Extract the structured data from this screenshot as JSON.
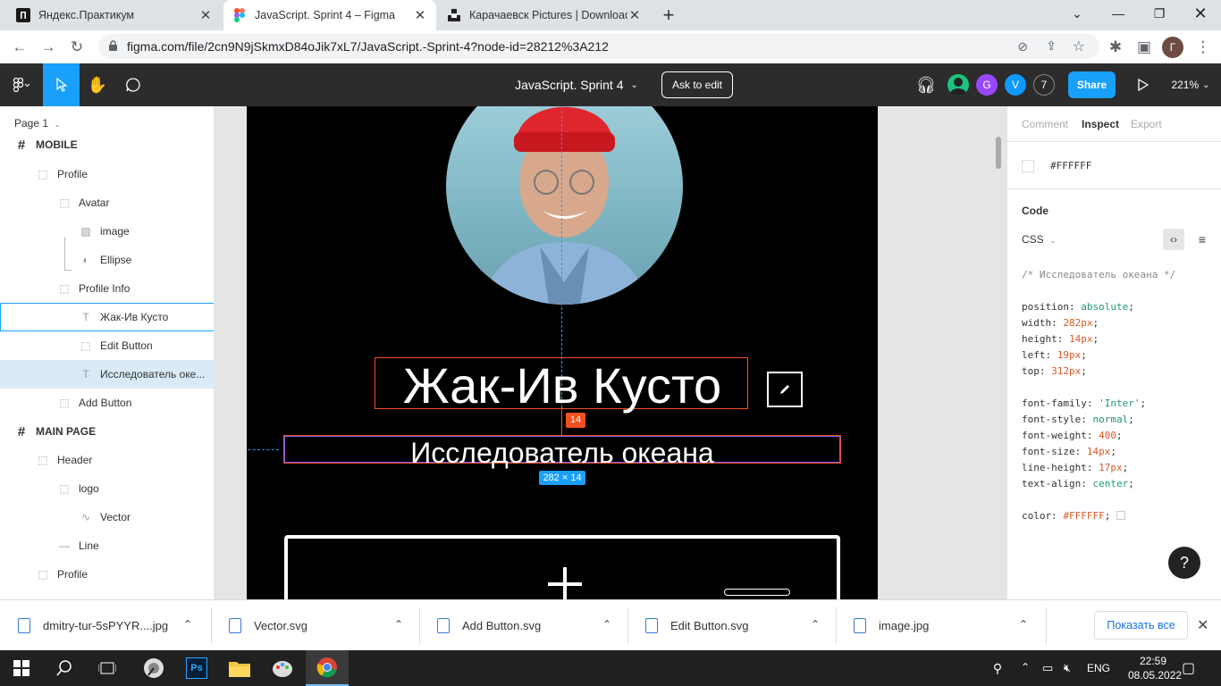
{
  "browser": {
    "tabs": [
      {
        "title": "Яндекс.Практикум",
        "active": false
      },
      {
        "title": "JavaScript. Sprint 4 – Figma",
        "active": true
      },
      {
        "title": "Карачаевск Pictures | Download",
        "active": false
      }
    ],
    "new_tab": "+",
    "url": "figma.com/file/2cn9N9jSkmxD84oJik7xL7/JavaScript.-Sprint-4?node-id=28212%3A212",
    "profile_initial": "Г"
  },
  "figma": {
    "file_title": "JavaScript. Sprint 4",
    "ask_to_edit": "Ask to edit",
    "share": "Share",
    "zoom": "221%",
    "users": [
      "G",
      "V"
    ],
    "user_count": "7",
    "page": "Page 1",
    "layers": [
      {
        "label": "MOBILE",
        "icon": "frame-icon",
        "indent": 0,
        "frame": true
      },
      {
        "label": "Profile",
        "icon": "group-dashed-icon",
        "indent": 1
      },
      {
        "label": "Avatar",
        "icon": "group-dashed-icon",
        "indent": 2
      },
      {
        "label": "image",
        "icon": "image-icon",
        "indent": 3
      },
      {
        "label": "Ellipse",
        "icon": "ellipse-half-icon",
        "indent": 3
      },
      {
        "label": "Profile Info",
        "icon": "group-dashed-icon",
        "indent": 2
      },
      {
        "label": "Жак-Ив Кусто",
        "icon": "text-icon",
        "indent": 3,
        "hover": true
      },
      {
        "label": "Edit Button",
        "icon": "group-dashed-icon",
        "indent": 3
      },
      {
        "label": "Исследователь оке...",
        "icon": "text-icon",
        "indent": 3,
        "selected": true
      },
      {
        "label": "Add Button",
        "icon": "group-dashed-icon",
        "indent": 2
      },
      {
        "label": "MAIN PAGE",
        "icon": "frame-icon",
        "indent": 0,
        "frame": true
      },
      {
        "label": "Header",
        "icon": "group-dashed-icon",
        "indent": 1
      },
      {
        "label": "logo",
        "icon": "group-dashed-icon",
        "indent": 2
      },
      {
        "label": "Vector",
        "icon": "vector-icon",
        "indent": 3
      },
      {
        "label": "Line",
        "icon": "line-icon",
        "indent": 2
      },
      {
        "label": "Profile",
        "icon": "group-dashed-icon",
        "indent": 1
      }
    ],
    "canvas": {
      "profile_name": "Жак-Ив Кусто",
      "profile_description": "Исследователь океана",
      "gap_badge": "14",
      "size_badge": "282 × 14"
    },
    "inspect": {
      "tabs": [
        "Comment",
        "Inspect",
        "Export"
      ],
      "active_tab": "Inspect",
      "color_value": "#FFFFFF",
      "code_heading": "Code",
      "language": "CSS",
      "comment": "/* Исследователь океана */",
      "props": [
        {
          "name": "position",
          "value": "absolute",
          "kind": "str"
        },
        {
          "name": "width",
          "value": "282px",
          "kind": "num"
        },
        {
          "name": "height",
          "value": "14px",
          "kind": "num"
        },
        {
          "name": "left",
          "value": "19px",
          "kind": "num"
        },
        {
          "name": "top",
          "value": "312px",
          "kind": "num"
        }
      ],
      "font_props": [
        {
          "name": "font-family",
          "value": "'Inter'",
          "kind": "str"
        },
        {
          "name": "font-style",
          "value": "normal",
          "kind": "str"
        },
        {
          "name": "font-weight",
          "value": "400",
          "kind": "num"
        },
        {
          "name": "font-size",
          "value": "14px",
          "kind": "num"
        },
        {
          "name": "line-height",
          "value": "17px",
          "kind": "num"
        },
        {
          "name": "text-align",
          "value": "center",
          "kind": "str"
        }
      ],
      "color_prop": {
        "name": "color",
        "value": "#FFFFFF"
      },
      "help": "?"
    }
  },
  "downloads": {
    "items": [
      "dmitry-tur-5sPYYR....jpg",
      "Vector.svg",
      "Add Button.svg",
      "Edit Button.svg",
      "image.jpg"
    ],
    "show_all": "Показать все"
  },
  "taskbar": {
    "lang": "ENG",
    "time": "22:59",
    "date": "08.05.2022"
  },
  "colors": {
    "figma_blue": "#18a0fb",
    "measure_red": "#f24e1e",
    "toolbar_dark": "#2c2c2c"
  }
}
